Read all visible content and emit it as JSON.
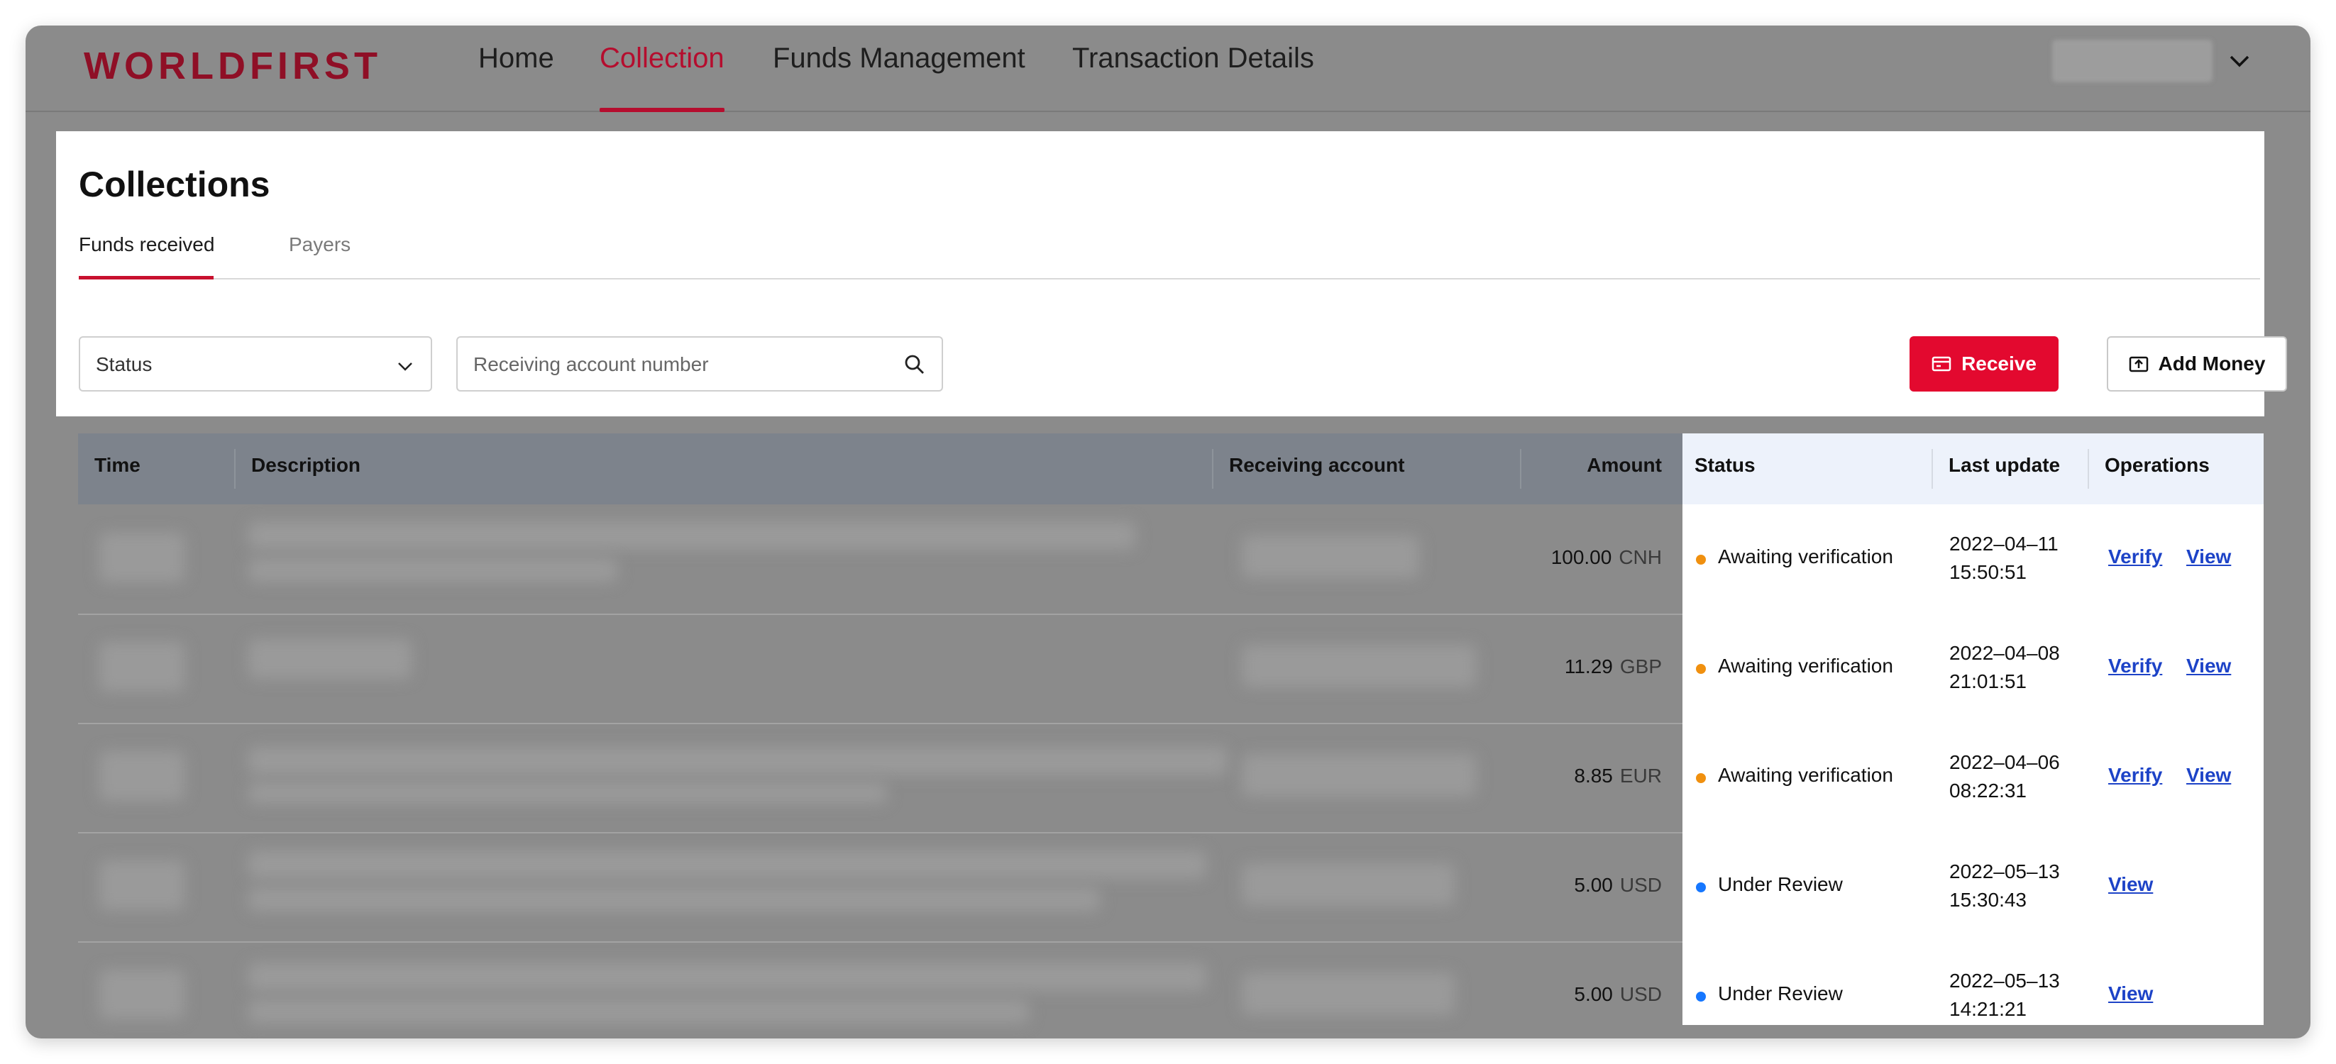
{
  "nav": {
    "logo": "WORLDFIRST",
    "items": [
      {
        "label": "Home"
      },
      {
        "label": "Collection"
      },
      {
        "label": "Funds Management"
      },
      {
        "label": "Transaction Details"
      }
    ],
    "active": "Collection"
  },
  "page": {
    "title": "Collections",
    "tabs": [
      {
        "label": "Funds received"
      },
      {
        "label": "Payers"
      }
    ]
  },
  "filters": {
    "status_placeholder": "Status",
    "search_placeholder": "Receiving account number"
  },
  "actions": {
    "receive_label": "Receive",
    "add_money_label": "Add Money"
  },
  "table": {
    "headers": {
      "time": "Time",
      "description": "Description",
      "receiving_account": "Receiving account",
      "amount": "Amount",
      "status": "Status",
      "last_update": "Last update",
      "operations": "Operations"
    },
    "rows": [
      {
        "amount": "100.00",
        "currency": "CNH",
        "status": "Awaiting verification",
        "status_color": "#f0900f",
        "update_date": "2022–04–11",
        "update_time": "15:50:51",
        "op_verify": "Verify",
        "op_view": "View"
      },
      {
        "amount": "11.29",
        "currency": "GBP",
        "status": "Awaiting verification",
        "status_color": "#f0900f",
        "update_date": "2022–04–08",
        "update_time": "21:01:51",
        "op_verify": "Verify",
        "op_view": "View"
      },
      {
        "amount": "8.85",
        "currency": "EUR",
        "status": "Awaiting verification",
        "status_color": "#f0900f",
        "update_date": "2022–04–06",
        "update_time": "08:22:31",
        "op_verify": "Verify",
        "op_view": "View"
      },
      {
        "amount": "5.00",
        "currency": "USD",
        "status": "Under Review",
        "status_color": "#1677ff",
        "update_date": "2022–05–13",
        "update_time": "15:30:43",
        "op_view": "View"
      },
      {
        "amount": "5.00",
        "currency": "USD",
        "status": "Under Review",
        "status_color": "#1677ff",
        "update_date": "2022–05–13",
        "update_time": "14:21:21",
        "op_view": "View"
      }
    ]
  },
  "colors": {
    "brand": "#8f0f26",
    "accent": "#e3092f",
    "link": "#1d43c7",
    "awaiting": "#f0900f",
    "review": "#1677ff"
  }
}
